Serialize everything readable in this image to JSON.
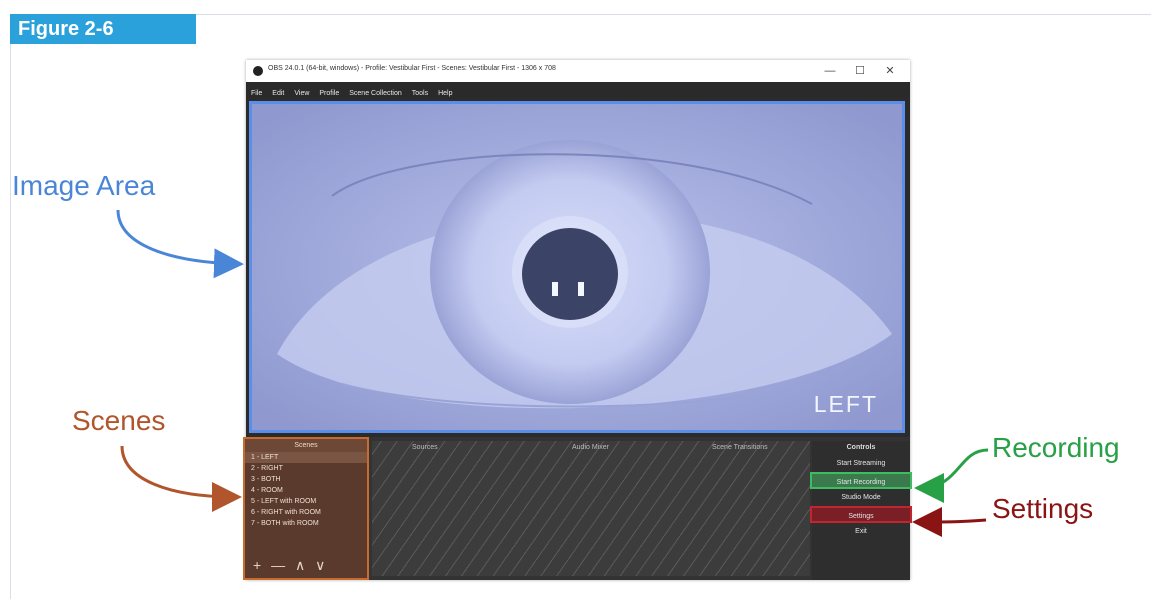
{
  "figure": {
    "label": "Figure 2-6"
  },
  "window": {
    "title": "OBS 24.0.1 (64-bit, windows) - Profile: Vestibular First - Scenes: Vestibular First - 1306 x 708",
    "controls": {
      "minimize": "—",
      "maximize": "☐",
      "close": "✕"
    }
  },
  "menu": [
    "File",
    "Edit",
    "View",
    "Profile",
    "Scene Collection",
    "Tools",
    "Help"
  ],
  "preview": {
    "label": "LEFT"
  },
  "scenes": {
    "header": "Scenes",
    "items": [
      "1 - LEFT",
      "2 - RIGHT",
      "3 - BOTH",
      "4 - ROOM",
      "5 - LEFT with ROOM",
      "6 - RIGHT with ROOM",
      "7 - BOTH with ROOM"
    ],
    "toolbar": "+ — ∧ ∨"
  },
  "dock_headers": {
    "sources": "Sources",
    "audio": "Audio Mixer",
    "transitions": "Scene Transitions"
  },
  "controls": {
    "header": "Controls",
    "start_streaming": "Start Streaming",
    "start_recording": "Start Recording",
    "studio_mode": "Studio Mode",
    "settings": "Settings",
    "exit": "Exit"
  },
  "annotations": {
    "image_area": "Image Area",
    "scenes": "Scenes",
    "recording": "Recording",
    "settings": "Settings"
  },
  "colors": {
    "figure_tab": "#2aa1da",
    "image_area": "#4a86d8",
    "scenes": "#b0552c",
    "recording": "#27a046",
    "settings": "#8a1414"
  }
}
